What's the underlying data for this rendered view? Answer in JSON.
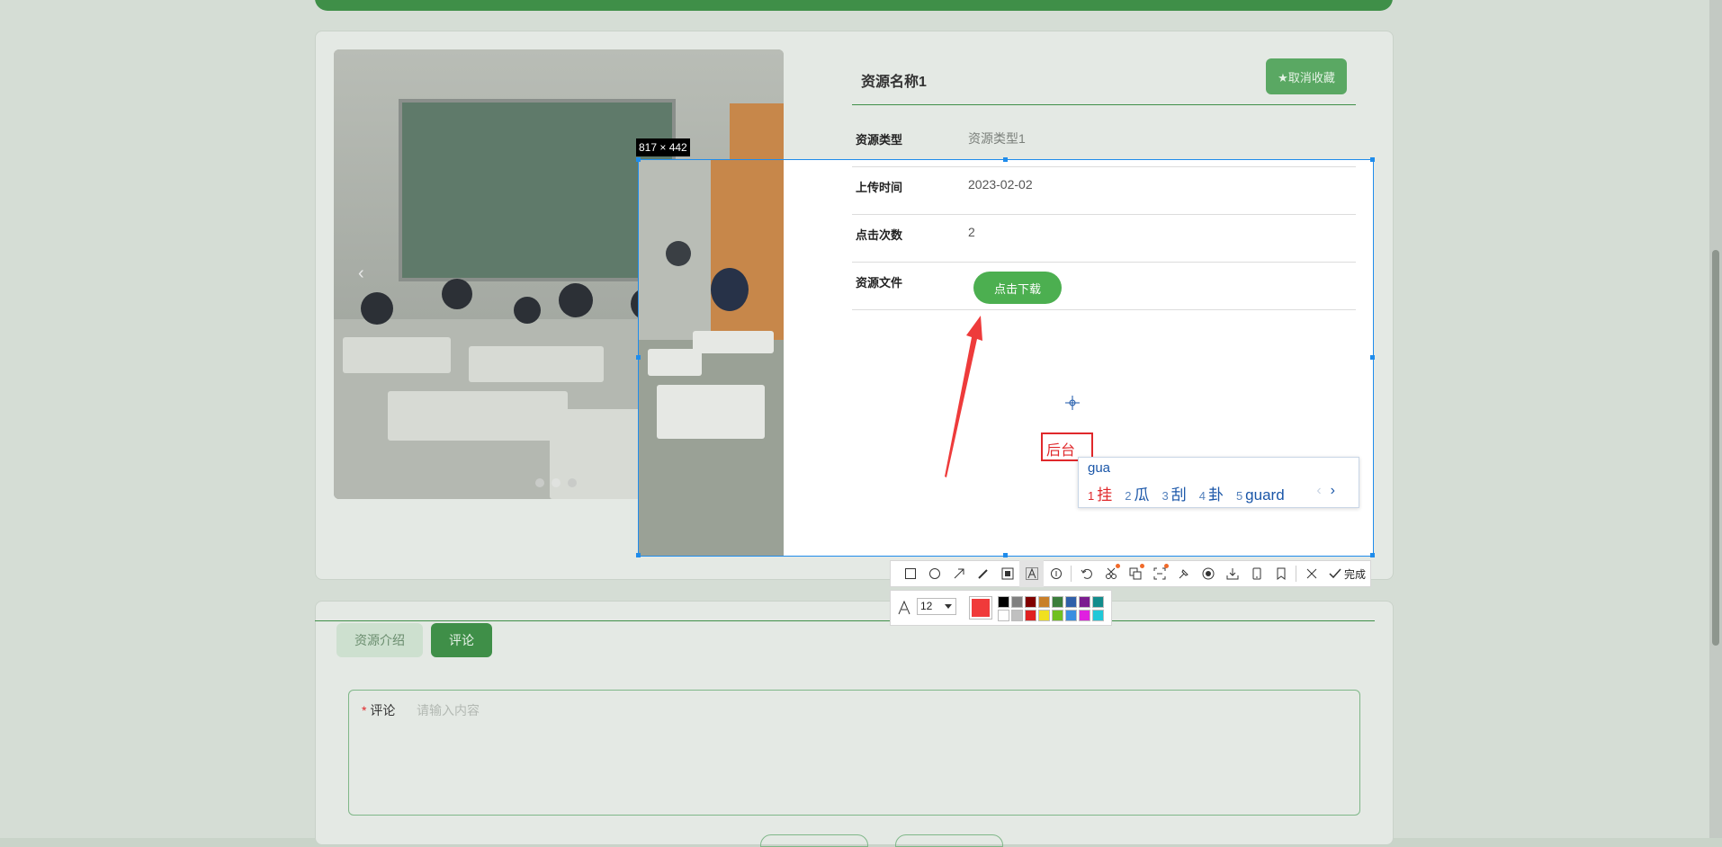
{
  "resource": {
    "name": "资源名称1",
    "fav_button": "★取消收藏",
    "rows": [
      {
        "label": "资源类型",
        "value": "资源类型1"
      },
      {
        "label": "上传时间",
        "value": "2023-02-02"
      },
      {
        "label": "点击次数",
        "value": "2"
      },
      {
        "label": "资源文件",
        "value": ""
      }
    ],
    "download_button": "点击下载"
  },
  "carousel": {
    "prev": "‹",
    "next": "›"
  },
  "screenshot_tool": {
    "size_label": "817 × 442",
    "text_annotation": "后台",
    "toolbar_done": "完成",
    "font_size": "12",
    "current_color": "#f03a3a",
    "palette": [
      "#000000",
      "#808080",
      "#800000",
      "#c87f2a",
      "#3b7d3b",
      "#2f5fa8",
      "#7b1d8f",
      "#138c8c",
      "#ffffff",
      "#c0c0c0",
      "#e02020",
      "#f0e020",
      "#70c020",
      "#3a8fe0",
      "#e020e0",
      "#20c8d8"
    ]
  },
  "ime": {
    "input": "gua",
    "candidates": [
      {
        "num": "1",
        "text": "挂"
      },
      {
        "num": "2",
        "text": "瓜"
      },
      {
        "num": "3",
        "text": "刮"
      },
      {
        "num": "4",
        "text": "卦"
      },
      {
        "num": "5",
        "text": "guard"
      }
    ],
    "prev": "‹",
    "next": "›"
  },
  "tabs": [
    {
      "label": "资源介绍"
    },
    {
      "label": "评论"
    }
  ],
  "comment": {
    "label": "评论",
    "required_mark": "*",
    "placeholder": "请输入内容"
  }
}
